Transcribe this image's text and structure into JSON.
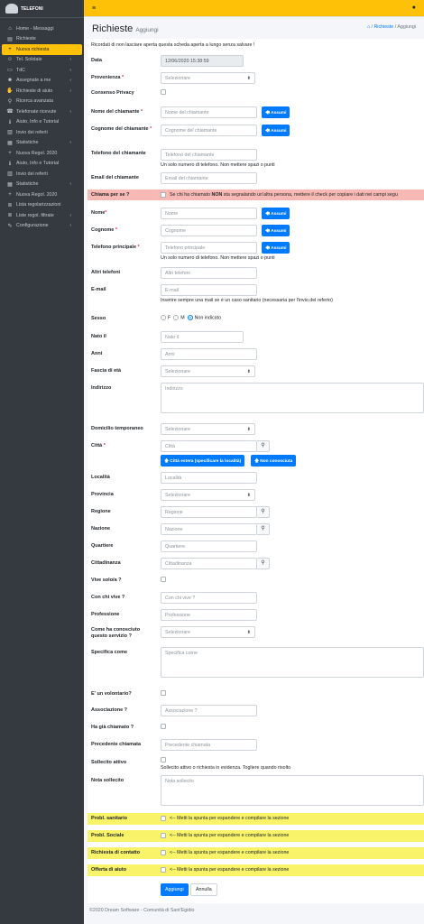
{
  "app": {
    "brand": "TELEFONI"
  },
  "sidebar": {
    "items": [
      {
        "label": "Home - Messaggi",
        "icon": "home"
      },
      {
        "label": "Richieste",
        "icon": "folder"
      },
      {
        "label": "Nuova richiesta",
        "icon": "plus",
        "active": true
      },
      {
        "label": "Tel. Solidale",
        "icon": "users",
        "arrow": true
      },
      {
        "label": "TdC",
        "icon": "card",
        "arrow": true
      },
      {
        "label": "Assegnate a me",
        "icon": "user-tag",
        "arrow": true
      },
      {
        "label": "Richieste di aiuto",
        "icon": "hands",
        "arrow": true
      },
      {
        "label": "Ricerca avanzata",
        "icon": "search"
      },
      {
        "label": "Telefonate ricevute",
        "icon": "phone",
        "arrow": true
      },
      {
        "label": "Aiuto, Info e Tutorial",
        "icon": "info"
      },
      {
        "label": "Invio dei referti",
        "icon": "file"
      },
      {
        "label": "Statistiche",
        "icon": "chart",
        "arrow": true
      },
      {
        "label": "Nuova Regol. 2020",
        "icon": "plus"
      },
      {
        "label": "Aiuto, Info e Tutorial",
        "icon": "info"
      },
      {
        "label": "Invio dei referti",
        "icon": "file"
      },
      {
        "label": "Statistiche",
        "icon": "chart",
        "arrow": true
      },
      {
        "label": "Nuova Regol. 2020",
        "icon": "plus"
      },
      {
        "label": "Lista regolarizzazioni",
        "icon": "list"
      },
      {
        "label": "Liste regol. filtrate",
        "icon": "list",
        "arrow": true
      },
      {
        "label": "Configurazione",
        "icon": "wrench",
        "arrow": true
      }
    ]
  },
  "header": {
    "title": "Richieste",
    "subtitle": "Aggiungi",
    "breadcrumb": [
      "Richieste",
      "Aggiungi"
    ]
  },
  "form": {
    "warning": "Ricordati di non lasciare aperta questa scheda aperta a lungo senza salvare !",
    "data_label": "Data",
    "data_value": "12/06/2020 15:38:59",
    "provenienza_label": "Provenienza",
    "select_placeholder": "Selezionare",
    "consenso_label": "Consenso Privacy",
    "nome_chiamante_label": "Nome del chiamante",
    "nome_chiamante_ph": "Nome del chiamante",
    "cognome_chiamante_label": "Cognome del chiamante",
    "cognome_chiamante_ph": "Cognome del chiamante",
    "assumi_label": "Assumi",
    "tel_chiamante_label": "Telefono del chiamante",
    "tel_chiamante_ph": "Telefono del chiamante",
    "tel_help": "Un solo numero di telefono. Non mettere spazi o punti",
    "email_chiamante_label": "Email del chiamante",
    "email_chiamante_ph": "Email del chiamante",
    "chiama_per_se_label": "Chiama per se ?",
    "chiama_per_se_help_pre": "Se chi ha chiamato ",
    "chiama_per_se_help_bold": "NON",
    "chiama_per_se_help_post": " sta segnalando un'altra persona, mettere il check per copiare i dati nei campi segu",
    "nome_label": "Nome",
    "nome_ph": "Nome",
    "cognome_label": "Cognome",
    "cognome_ph": "Cognome",
    "tel_principale_label": "Telefono principale",
    "tel_principale_ph": "Telefono principale",
    "altri_tel_label": "Altri telefoni",
    "altri_tel_ph": "Altri telefoni",
    "email_label": "E-mail",
    "email_ph": "E-mail",
    "email_help": "Inserire sempre una mail se è un caso sanitario (necessaria per l'invio del referto)",
    "sesso_label": "Sesso",
    "sesso_options": [
      "F",
      "M",
      "Non indicato"
    ],
    "nato_label": "Nato il",
    "nato_ph": "Nato il",
    "anni_label": "Anni",
    "anni_ph": "Anni",
    "fascia_label": "Fascia di età",
    "indirizzo_label": "Indirizzo",
    "indirizzo_ph": "Indirizzo",
    "domicilio_label": "Domicilio temporaneo",
    "citta_label": "Città",
    "citta_ph": "Città",
    "citta_estera_label": "Città estera (specificare la località)",
    "non_conosciuta_label": "Non conosciuta",
    "localita_label": "Località",
    "localita_ph": "Località",
    "provincia_label": "Provincia",
    "regione_label": "Regione",
    "regione_ph": "Regione",
    "nazione_label": "Nazione",
    "nazione_ph": "Nazione",
    "quartiere_label": "Quartiere",
    "quartiere_ph": "Quartiere",
    "cittadinanza_label": "Cittadinanza",
    "cittadinanza_ph": "Cittadinanza",
    "vive_solo_label": "Vive solo/a ?",
    "con_chi_label": "Con chi vive ?",
    "con_chi_ph": "Con chi vive ?",
    "professione_label": "Professione",
    "professione_ph": "Professione",
    "come_label": "Come ha conosciuto questo servizio ?",
    "specifica_label": "Specifica come",
    "specifica_ph": "Specifica come",
    "volontario_label": "E' un volontario?",
    "associazione_label": "Associazione ?",
    "associazione_ph": "Associazione ?",
    "gia_chiamato_label": "Ha già chiamato ?",
    "prec_chiamata_label": "Precedente chiamata",
    "prec_chiamata_ph": "Precedente chiamata",
    "sollecito_label": "Sollecito attivo",
    "sollecito_help": "Sollecito attivo o richiesta in evidenza. Togliere quando risolto",
    "nota_label": "Nota sollecito",
    "nota_ph": "Nota sollecito",
    "expand_help": "<-- Metti la spunta per espandere e compilare la sezione",
    "sections": [
      "Probl. sanitario",
      "Probl. Sociale",
      "Richiesta di contatto",
      "Offerta di aiuto"
    ],
    "aggiungi_label": "Aggiungi",
    "annulla_label": "Annulla"
  },
  "footer": {
    "text": "©2020 Dream Software - Comunità di Sant'Egidio"
  }
}
